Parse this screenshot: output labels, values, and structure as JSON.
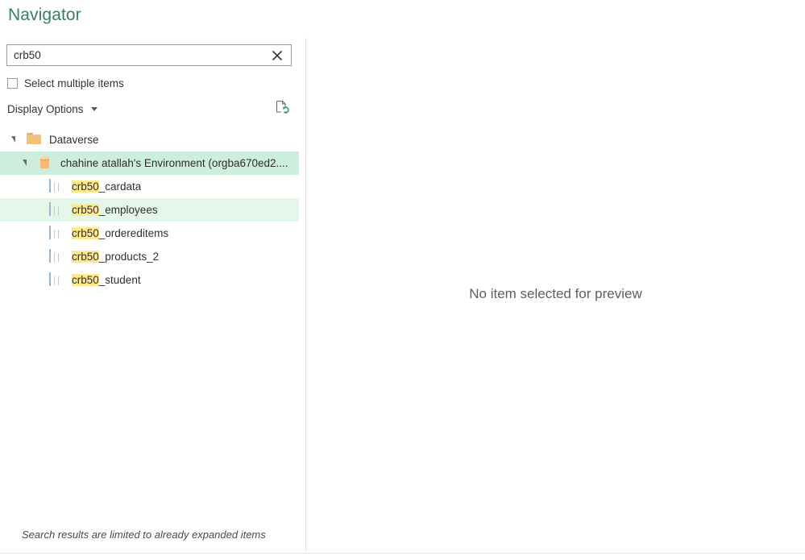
{
  "window": {
    "title": "Navigator"
  },
  "search": {
    "value": "crb50",
    "placeholder": "",
    "clear_icon": "close-icon"
  },
  "options": {
    "select_multiple_label": "Select multiple items",
    "select_multiple_checked": false,
    "display_options_label": "Display Options",
    "refresh_icon": "refresh-preview-icon"
  },
  "tree": {
    "nodes": [
      {
        "label": "Dataverse",
        "icon": "folder-icon",
        "level": 0,
        "expanded": true,
        "state": "none"
      },
      {
        "label": "chahine atallah's Environment (orgba670ed2....",
        "icon": "database-icon",
        "level": 1,
        "expanded": true,
        "state": "selected"
      },
      {
        "label_highlight": "crb50",
        "label_rest": "_cardata",
        "icon": "table-icon",
        "level": 2,
        "expanded": false,
        "state": "none"
      },
      {
        "label_highlight": "crb50",
        "label_rest": "_employees",
        "icon": "table-icon",
        "level": 2,
        "expanded": false,
        "state": "hover"
      },
      {
        "label_highlight": "crb50",
        "label_rest": "_ordereditems",
        "icon": "table-icon",
        "level": 2,
        "expanded": false,
        "state": "none"
      },
      {
        "label_highlight": "crb50",
        "label_rest": "_products_2",
        "icon": "table-icon",
        "level": 2,
        "expanded": false,
        "state": "none"
      },
      {
        "label_highlight": "crb50",
        "label_rest": "_student",
        "icon": "table-icon",
        "level": 2,
        "expanded": false,
        "state": "none"
      }
    ]
  },
  "footer": {
    "note": "Search results are limited to already expanded items"
  },
  "preview": {
    "empty_message": "No item selected for preview"
  },
  "colors": {
    "title_green": "#3a7d5f",
    "selected_row": "#cdeedc",
    "hover_row": "#e4f5ea",
    "search_highlight": "#ffe98f",
    "table_icon_header": "#4a90c4",
    "folder_orange": "#f2c27c"
  }
}
